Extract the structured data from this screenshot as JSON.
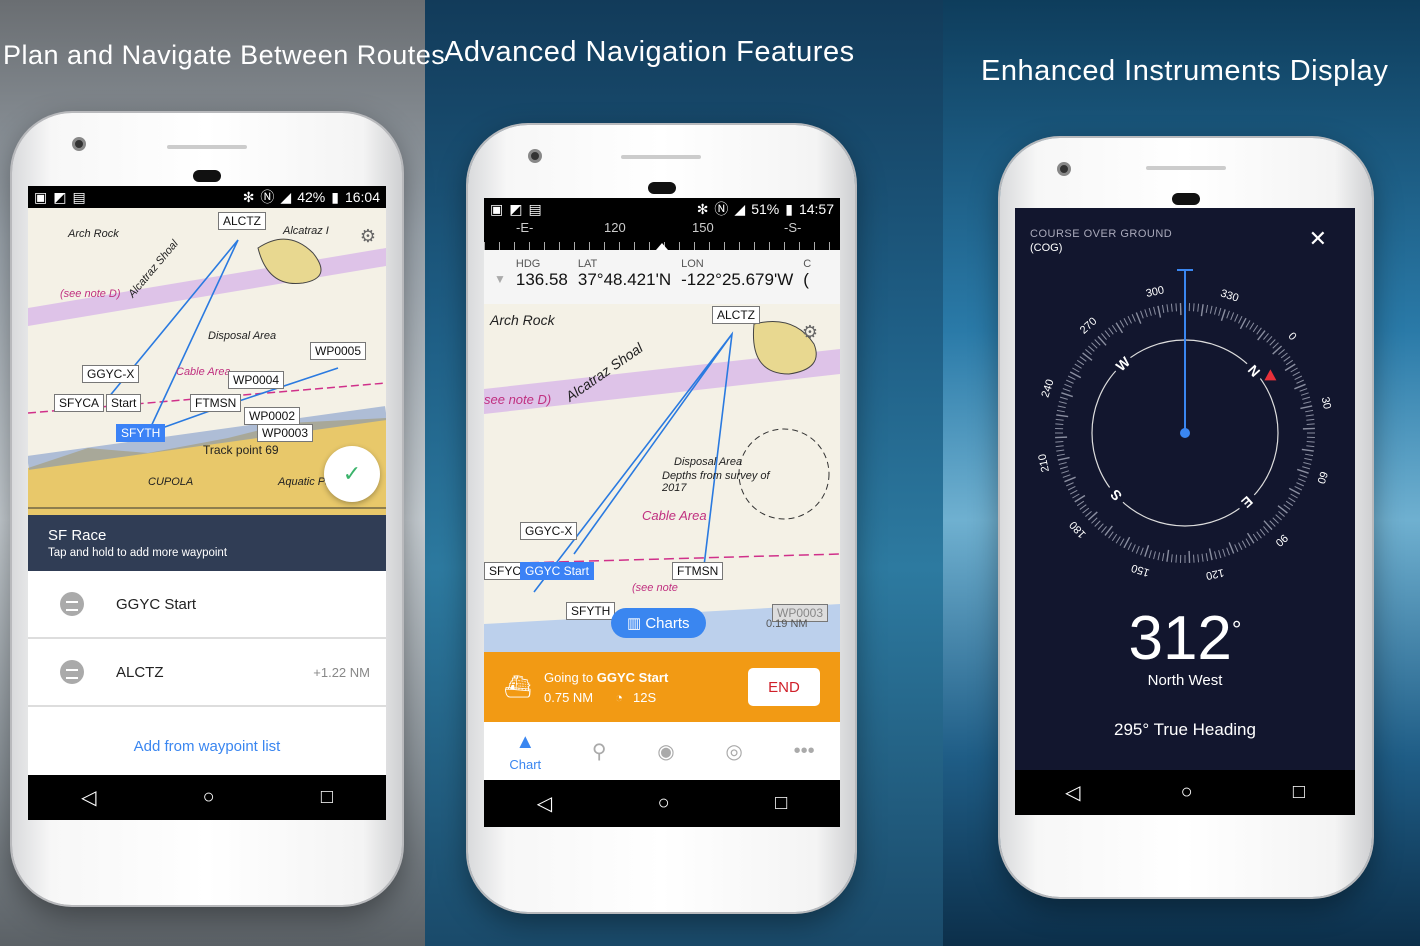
{
  "panels": [
    {
      "headline": "Plan and Navigate Between Routes"
    },
    {
      "headline": "Advanced Navigation Features"
    },
    {
      "headline": "Enhanced Instruments Display"
    }
  ],
  "phone1": {
    "status": {
      "battery": "42%",
      "time": "16:04"
    },
    "map_labels": [
      "Arch Rock",
      "Alcatraz Shoal",
      "Alcatraz I",
      "(see note D)",
      "Disposal Area",
      "Cable Area",
      "Track point 69",
      "Aquatic Park",
      "CUPOLA"
    ],
    "waypoints": [
      "ALCTZ",
      "GGYC-X",
      "SFYCA",
      "Start",
      "FTMSN",
      "WP0004",
      "WP0005",
      "WP0002",
      "WP0003",
      "SFYTH"
    ],
    "route": {
      "title": "SF Race",
      "subtitle": "Tap and hold to add more waypoint"
    },
    "list": [
      {
        "name": "GGYC Start",
        "distance": ""
      },
      {
        "name": "ALCTZ",
        "distance": "+1.22 NM"
      }
    ],
    "add_link": "Add from waypoint list",
    "confirm_icon": "check-icon"
  },
  "phone2": {
    "status": {
      "battery": "51%",
      "time": "14:57"
    },
    "compass_strip": [
      "-E-",
      "120",
      "150",
      "-S-"
    ],
    "info": [
      {
        "label": "HDG",
        "value": "136.58"
      },
      {
        "label": "LAT",
        "value": "37°48.421'N"
      },
      {
        "label": "LON",
        "value": "-122°25.679'W"
      },
      {
        "label": "C",
        "value": "("
      }
    ],
    "map_labels": [
      "Arch Rock",
      "Alcatraz Shoal",
      "see note D)",
      "Disposal Area",
      "Depths from survey of 2017",
      "Cable Area",
      "(see note"
    ],
    "waypoints": [
      "ALCTZ",
      "GGYC-X",
      "SFYCA",
      "GGYC Start",
      "FTMSN",
      "SFYTH",
      "WP0003"
    ],
    "wp_distance": "0.19 NM",
    "charts_button": "Charts",
    "nav": {
      "going_to_prefix": "Going to ",
      "destination": "GGYC Start",
      "distance": "0.75 NM",
      "time": "12S",
      "end": "END"
    },
    "tabs": [
      {
        "label": "Chart",
        "icon": "navigation-arrow-icon",
        "active": true
      },
      {
        "label": "",
        "icon": "pin-icon"
      },
      {
        "label": "",
        "icon": "route-pin-icon"
      },
      {
        "label": "",
        "icon": "radar-icon"
      },
      {
        "label": "",
        "icon": "more-icon"
      }
    ],
    "colors": {
      "orange": "#f29a14",
      "accent": "#3a86f0"
    }
  },
  "phone3": {
    "title": "COURSE OVER GROUND",
    "subtitle": "(COG)",
    "heading": 312,
    "degree_symbol": "°",
    "direction": "North West",
    "true_heading": "295° True Heading",
    "dial_labels": [
      "0",
      "30",
      "60",
      "90",
      "120",
      "150",
      "180",
      "210",
      "240",
      "270",
      "300",
      "330"
    ],
    "cardinals": [
      "N",
      "E",
      "S",
      "W"
    ],
    "colors": {
      "bg": "#12162e",
      "needle": "#3a86f0",
      "north": "#e8303a"
    }
  }
}
